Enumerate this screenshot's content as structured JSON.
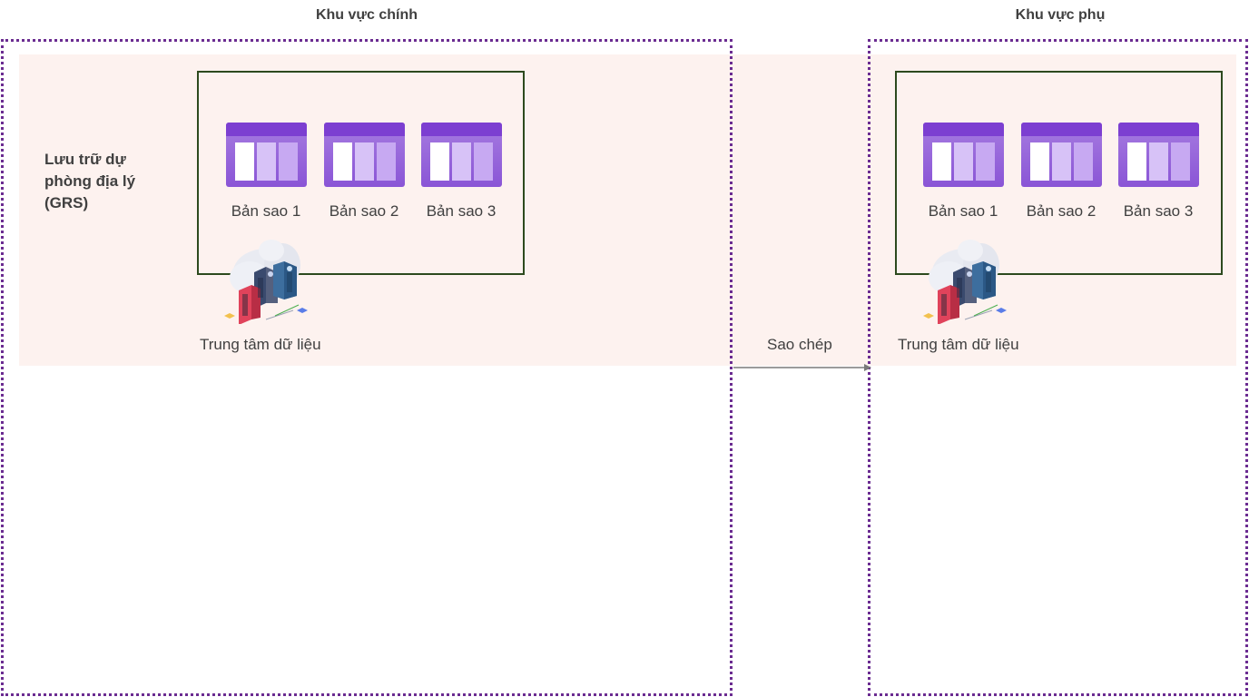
{
  "primary_region": {
    "title": "Khu vực chính",
    "grs_label": "Lưu trữ dự phòng địa lý (GRS)",
    "replicas": [
      "Bản sao 1",
      "Bản sao 2",
      "Bản sao 3"
    ],
    "datacenter_label": "Trung tâm dữ liệu"
  },
  "secondary_region": {
    "title": "Khu vực phụ",
    "replicas": [
      "Bản sao 1",
      "Bản sao 2",
      "Bản sao 3"
    ],
    "datacenter_label": "Trung tâm dữ liệu"
  },
  "replication": {
    "label": "Sao chép"
  },
  "colors": {
    "region_border": "#6b2c91",
    "band_fill": "#fdf2ef",
    "storage_border": "#2d4a1e",
    "replica_tile": "#8a55d6"
  },
  "icons": {
    "replica": "storage-table-icon",
    "datacenter": "cloud-datacenter-icon"
  }
}
